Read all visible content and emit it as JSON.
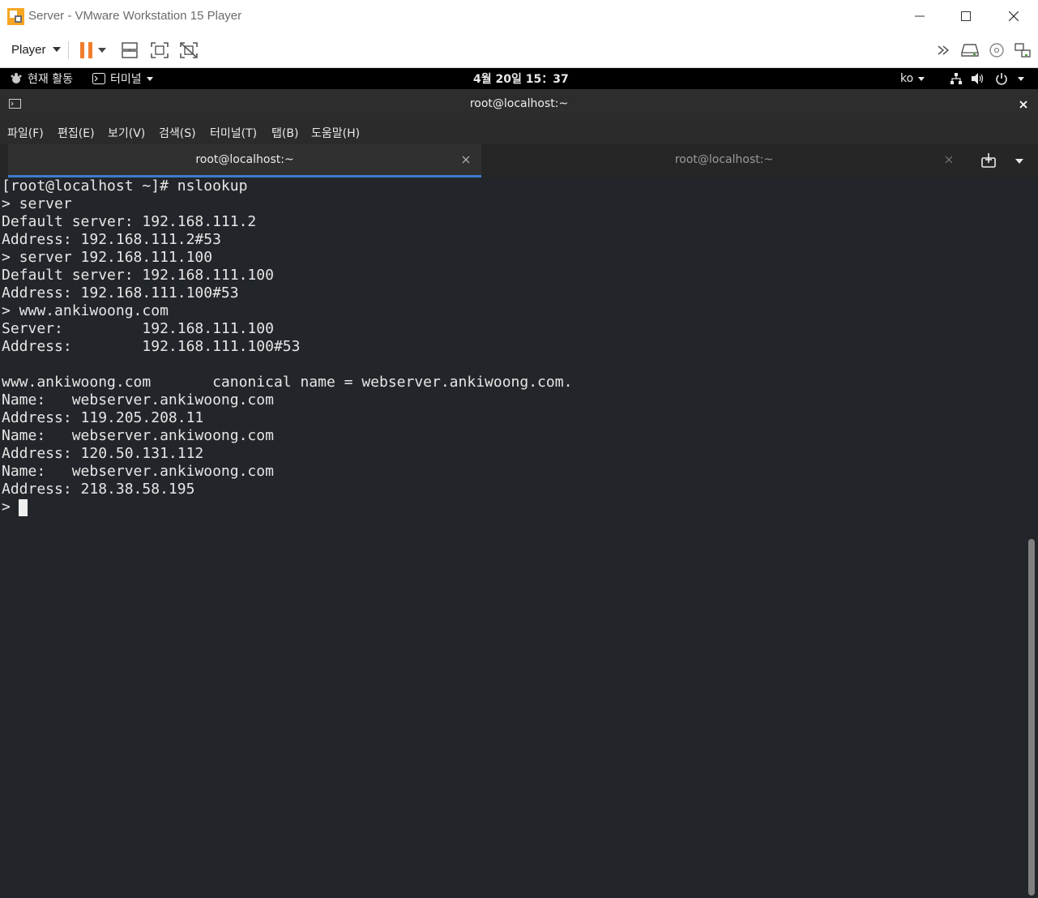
{
  "window": {
    "title": "Server - VMware Workstation 15 Player",
    "player_menu_label": "Player"
  },
  "toolbar": {
    "icons": [
      "pause-icon",
      "send-ctrl-alt-del-icon",
      "fullscreen-icon",
      "unity-icon"
    ],
    "right_icons": [
      "overflow-icon",
      "hard-disk-icon",
      "cd-dvd-icon",
      "network-adapter-icon"
    ],
    "pause_color": "#f07d2d"
  },
  "gnome_topbar": {
    "activities": "현재 활동",
    "app_menu": "터미널",
    "clock": "4월 20일  15：37",
    "language": "ko"
  },
  "terminal": {
    "header_title": "root@localhost:~",
    "menu": [
      "파일(F)",
      "편집(E)",
      "보기(V)",
      "검색(S)",
      "터미널(T)",
      "탭(B)",
      "도움말(H)"
    ],
    "tabs": [
      {
        "label": "root@localhost:~",
        "active": true
      },
      {
        "label": "root@localhost:~",
        "active": false
      }
    ],
    "lines": [
      "[root@localhost ~]# nslookup",
      "> server",
      "Default server: 192.168.111.2",
      "Address: 192.168.111.2#53",
      "> server 192.168.111.100",
      "Default server: 192.168.111.100",
      "Address: 192.168.111.100#53",
      "> www.ankiwoong.com",
      "Server:         192.168.111.100",
      "Address:        192.168.111.100#53",
      "",
      "www.ankiwoong.com       canonical name = webserver.ankiwoong.com.",
      "Name:   webserver.ankiwoong.com",
      "Address: 119.205.208.11",
      "Name:   webserver.ankiwoong.com",
      "Address: 120.50.131.112",
      "Name:   webserver.ankiwoong.com",
      "Address: 218.38.58.195",
      "> "
    ],
    "background_color": "#22262a",
    "accent_color": "#3d7bcf"
  }
}
